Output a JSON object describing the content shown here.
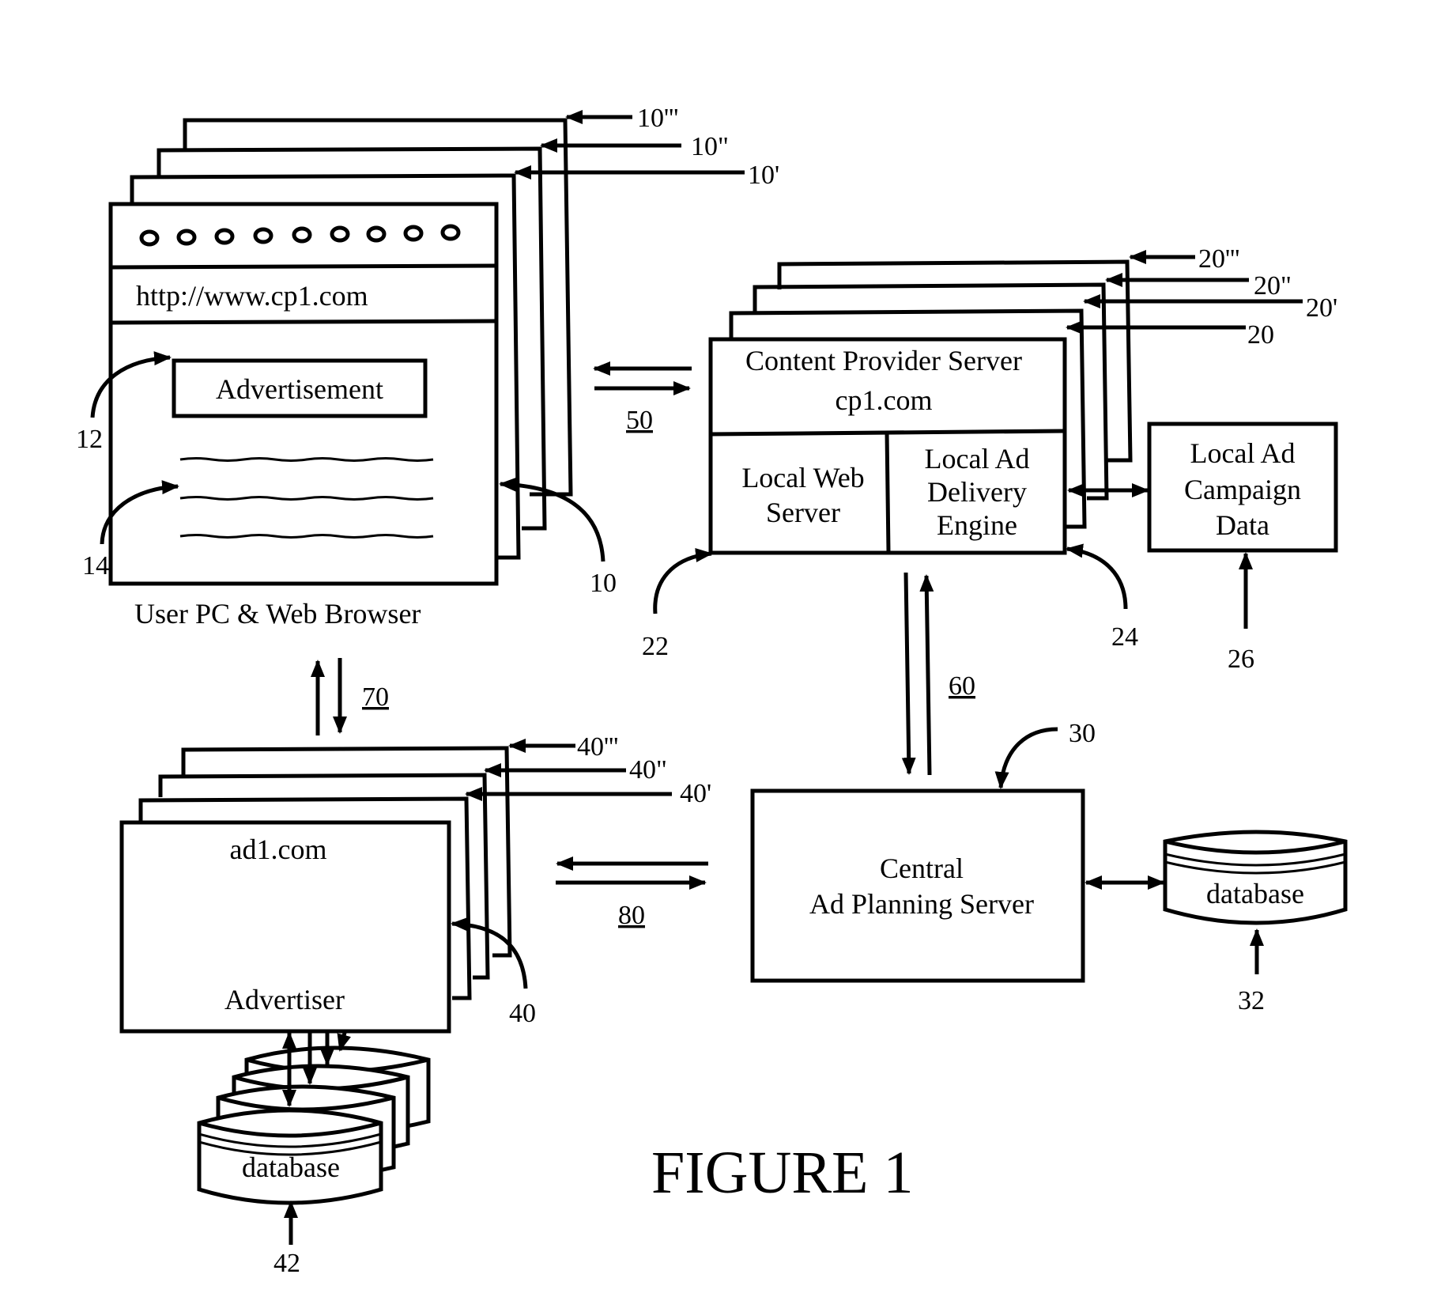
{
  "figure": {
    "title": "FIGURE 1"
  },
  "user_pc": {
    "url": "http://www.cp1.com",
    "ad_label": "Advertisement",
    "caption": "User PC & Web Browser",
    "toolbar_dots": 9,
    "refs": {
      "main": "10",
      "ad": "12",
      "content": "14",
      "stack": [
        "10'",
        "10\"",
        "10'''"
      ]
    }
  },
  "content_provider": {
    "title_line1": "Content Provider Server",
    "title_line2": "cp1.com",
    "web_server_line1": "Local Web",
    "web_server_line2": "Server",
    "ad_engine_line1": "Local Ad",
    "ad_engine_line2": "Delivery",
    "ad_engine_line3": "Engine",
    "refs": {
      "main": "20",
      "web_server": "22",
      "ad_engine": "24",
      "stack": [
        "20'",
        "20\"",
        "20'''"
      ]
    }
  },
  "campaign_data": {
    "line1": "Local Ad",
    "line2": "Campaign",
    "line3": "Data",
    "ref": "26"
  },
  "central_server": {
    "line1": "Central",
    "line2": "Ad Planning Server",
    "ref": "30"
  },
  "central_db": {
    "label": "database",
    "ref": "32"
  },
  "advertiser": {
    "domain": "ad1.com",
    "label": "Advertiser",
    "refs": {
      "main": "40",
      "stack": [
        "40'",
        "40\"",
        "40'''"
      ]
    }
  },
  "advertiser_db": {
    "label": "database",
    "ref": "42"
  },
  "links": {
    "browser_content": "50",
    "content_central": "60",
    "browser_advertiser": "70",
    "advertiser_central": "80"
  }
}
